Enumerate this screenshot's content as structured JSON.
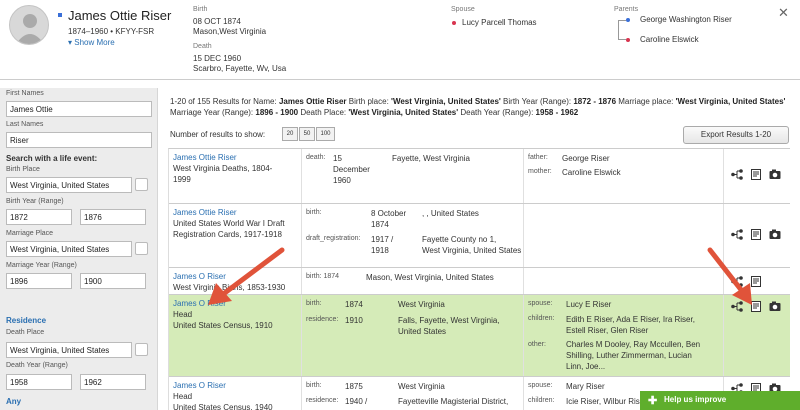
{
  "person": {
    "name": "James Ottie Riser",
    "meta": "1874–1960 • KFYY-FSR",
    "show_more": "Show More",
    "birth_label": "Birth",
    "birth_date": "08 OCT 1874",
    "birth_place": "Mason,West Virginia",
    "death_label": "Death",
    "death_date": "15 DEC 1960",
    "death_place": "Scarbro, Fayette, Wv, Usa",
    "spouse_label": "Spouse",
    "spouse": "Lucy Parcell Thomas",
    "parents_label": "Parents",
    "father": "George Washington Riser",
    "mother": "Caroline Elswick",
    "close": "✕"
  },
  "sidebar": {
    "first_names_label": "First Names",
    "first_names_value": "James Ottie",
    "last_names_label": "Last Names",
    "last_names_value": "Riser",
    "life_event_heading": "Search with a life event:",
    "birth_place_label": "Birth Place",
    "birth_place_value": "West Virginia, United States",
    "birth_year_label": "Birth Year (Range)",
    "birth_year_from": "1872",
    "birth_year_to": "1876",
    "marriage_place_label": "Marriage Place",
    "marriage_place_value": "West Virginia, United States",
    "marriage_year_label": "Marriage Year (Range)",
    "marriage_year_from": "1896",
    "marriage_year_to": "1900",
    "residence_link": "Residence",
    "death_place_label": "Death Place",
    "death_place_value": "West Virginia, United States",
    "death_year_label": "Death Year (Range)",
    "death_year_from": "1958",
    "death_year_to": "1962",
    "any_link": "Any"
  },
  "summary": {
    "prefix": "1-20 of 155 Results for Name:",
    "name": "James Ottie Riser",
    "birth_place_label": "Birth place:",
    "birth_place": "'West Virginia, United States'",
    "birth_year_label": "Birth Year (Range):",
    "birth_year": "1872 - 1876",
    "marriage_place_label": "Marriage place:",
    "marriage_place_a": "'West",
    "marriage_place_b": "Virginia, United States'",
    "marriage_year_label": "Marriage Year (Range):",
    "marriage_year": "1896 - 1900",
    "death_place_label": "Death Place:",
    "death_place": "'West Virginia, United States'",
    "death_year_label": "Death Year (Range):",
    "death_year": "1958 - 1962"
  },
  "controls": {
    "num_results_label": "Number of results to show:",
    "options": [
      "20",
      "50",
      "100"
    ],
    "export_label": "Export Results 1-20"
  },
  "results": [
    {
      "name": "James Ottie Riser",
      "lines": [
        "West Virginia Deaths, 1804-",
        "1999"
      ],
      "events": [
        {
          "label": "death:",
          "date": "15\nDecember\n1960",
          "place": "Fayette, West Virginia"
        }
      ],
      "relatives": [
        {
          "label": "father:",
          "value": "George Riser"
        },
        {
          "label": "mother:",
          "value": "Caroline Elswick"
        }
      ]
    },
    {
      "name": "James Ottie Riser",
      "lines": [
        "United States World War I Draft",
        "Registration Cards, 1917-1918"
      ],
      "events": [
        {
          "label": "birth:",
          "date": "8 October\n1874",
          "place": ", , United States"
        },
        {
          "label": "draft_registration:",
          "date": "1917 /\n1918",
          "place": "Fayette County no 1,\nWest Virginia, United States"
        }
      ],
      "relatives": []
    },
    {
      "name": "James O Riser",
      "lines": [
        "West Virginia Births, 1853-1930"
      ],
      "events": [
        {
          "label": "birth: 1874",
          "date": "",
          "place": "Mason, West Virginia, United States"
        }
      ],
      "relatives": []
    },
    {
      "name": "James O Riser",
      "lines": [
        "Head",
        "United States Census, 1910"
      ],
      "events": [
        {
          "label": "birth:",
          "date": "1874",
          "place": "West Virginia"
        },
        {
          "label": "residence:",
          "date": "1910",
          "place": "Falls, Fayette, West Virginia,\nUnited States"
        }
      ],
      "relatives": [
        {
          "label": "spouse:",
          "value": "Lucy E Riser"
        },
        {
          "label": "children:",
          "value": "Edith E Riser, Ada E Riser, Ira Riser,\nEstell Riser, Glen Riser"
        },
        {
          "label": "other:",
          "value": "Charles M Dooley, Ray Mccullen, Ben\nShilling, Luther Zimmerman, Lucian\nLinn, Joe..."
        }
      ]
    },
    {
      "name": "James O Riser",
      "lines": [
        "Head",
        "United States Census, 1940"
      ],
      "events": [
        {
          "label": "birth:",
          "date": "1875",
          "place": "West Virginia"
        },
        {
          "label": "residence:",
          "date": "1940 /",
          "place": "Fayetteville Magisterial District,"
        }
      ],
      "relatives": [
        {
          "label": "spouse:",
          "value": "Mary Riser"
        },
        {
          "label": "children:",
          "value": "Icie Riser, Wilbur Riser"
        }
      ]
    }
  ],
  "help_button": "Help us improve",
  "colors": {
    "link": "#2a6fb1",
    "highlight_row": "#d5ebb8",
    "arrow": "#e0533a",
    "help_green": "#5fae2c",
    "male_blue": "#3a6fd8",
    "female_red": "#d8344f"
  },
  "icons": [
    "tree-icon",
    "record-icon",
    "image-icon",
    "arrow-annotation",
    "plus-icon"
  ]
}
